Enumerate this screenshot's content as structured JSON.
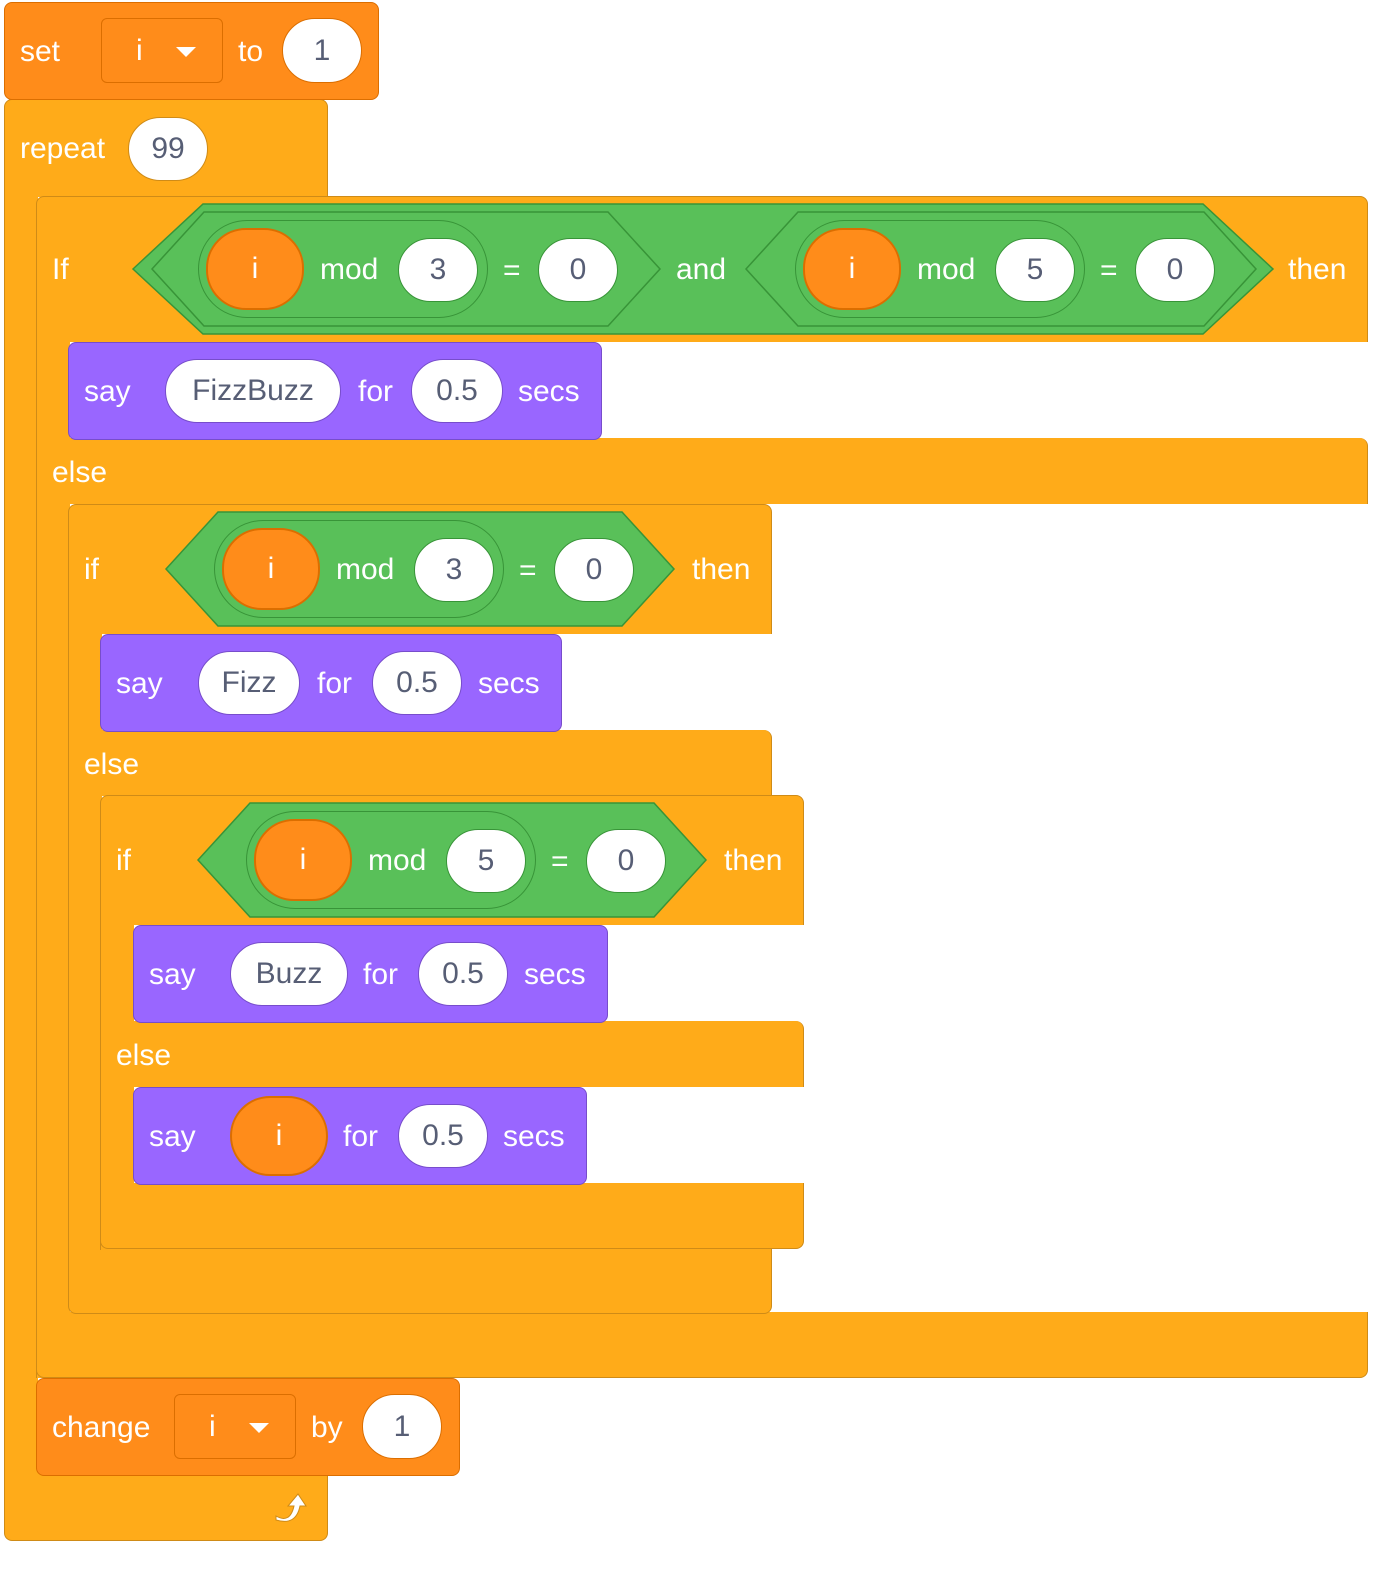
{
  "script": {
    "set_block": {
      "label": "set",
      "variable": "i",
      "to_label": "to",
      "value": "1"
    },
    "repeat_block": {
      "label": "repeat",
      "count": "99"
    },
    "if1": {
      "if_label": "If",
      "then_label": "then",
      "and_label": "and",
      "cond_a": {
        "var": "i",
        "op": "mod",
        "n": "3",
        "eq": "=",
        "rhs": "0"
      },
      "cond_b": {
        "var": "i",
        "op": "mod",
        "n": "5",
        "eq": "=",
        "rhs": "0"
      },
      "say": {
        "label": "say",
        "text": "FizzBuzz",
        "for_label": "for",
        "secs": "0.5",
        "secs_label": "secs"
      },
      "else_label": "else"
    },
    "if2": {
      "if_label": "if",
      "then_label": "then",
      "cond": {
        "var": "i",
        "op": "mod",
        "n": "3",
        "eq": "=",
        "rhs": "0"
      },
      "say": {
        "label": "say",
        "text": "Fizz",
        "for_label": "for",
        "secs": "0.5",
        "secs_label": "secs"
      },
      "else_label": "else"
    },
    "if3": {
      "if_label": "if",
      "then_label": "then",
      "cond": {
        "var": "i",
        "op": "mod",
        "n": "5",
        "eq": "=",
        "rhs": "0"
      },
      "say": {
        "label": "say",
        "text": "Buzz",
        "for_label": "for",
        "secs": "0.5",
        "secs_label": "secs"
      },
      "else_label": "else",
      "say_else": {
        "label": "say",
        "var": "i",
        "for_label": "for",
        "secs": "0.5",
        "secs_label": "secs"
      }
    },
    "change_block": {
      "label": "change",
      "variable": "i",
      "by_label": "by",
      "value": "1"
    },
    "loop_icon": "loop-arrow-icon"
  },
  "colors": {
    "control": "#FFAB19",
    "variables": "#FF8C1A",
    "looks": "#9966FF",
    "operators": "#59C059",
    "input_text": "#575E75"
  }
}
